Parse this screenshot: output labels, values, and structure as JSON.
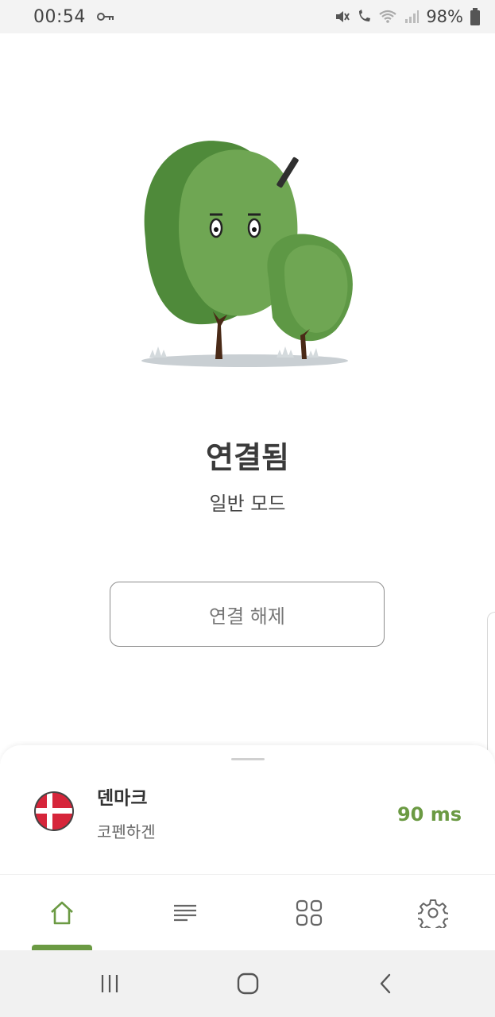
{
  "status_bar": {
    "time": "00:54",
    "battery": "98%",
    "icons": [
      "vpn-key-icon",
      "mute-icon",
      "wifi-call-icon",
      "wifi-icon",
      "signal-icon",
      "battery-icon"
    ]
  },
  "main": {
    "status_title": "연결됨",
    "mode": "일반 모드",
    "disconnect_label": "연결 해제"
  },
  "server": {
    "country": "덴마크",
    "city": "코펜하겐",
    "latency": "90 ms",
    "flag_icon": "denmark-flag-icon"
  },
  "nav": {
    "items": [
      "home-icon",
      "list-icon",
      "grid-icon",
      "settings-icon"
    ],
    "active": "home"
  },
  "colors": {
    "accent": "#6b9a43",
    "text": "#333333"
  }
}
